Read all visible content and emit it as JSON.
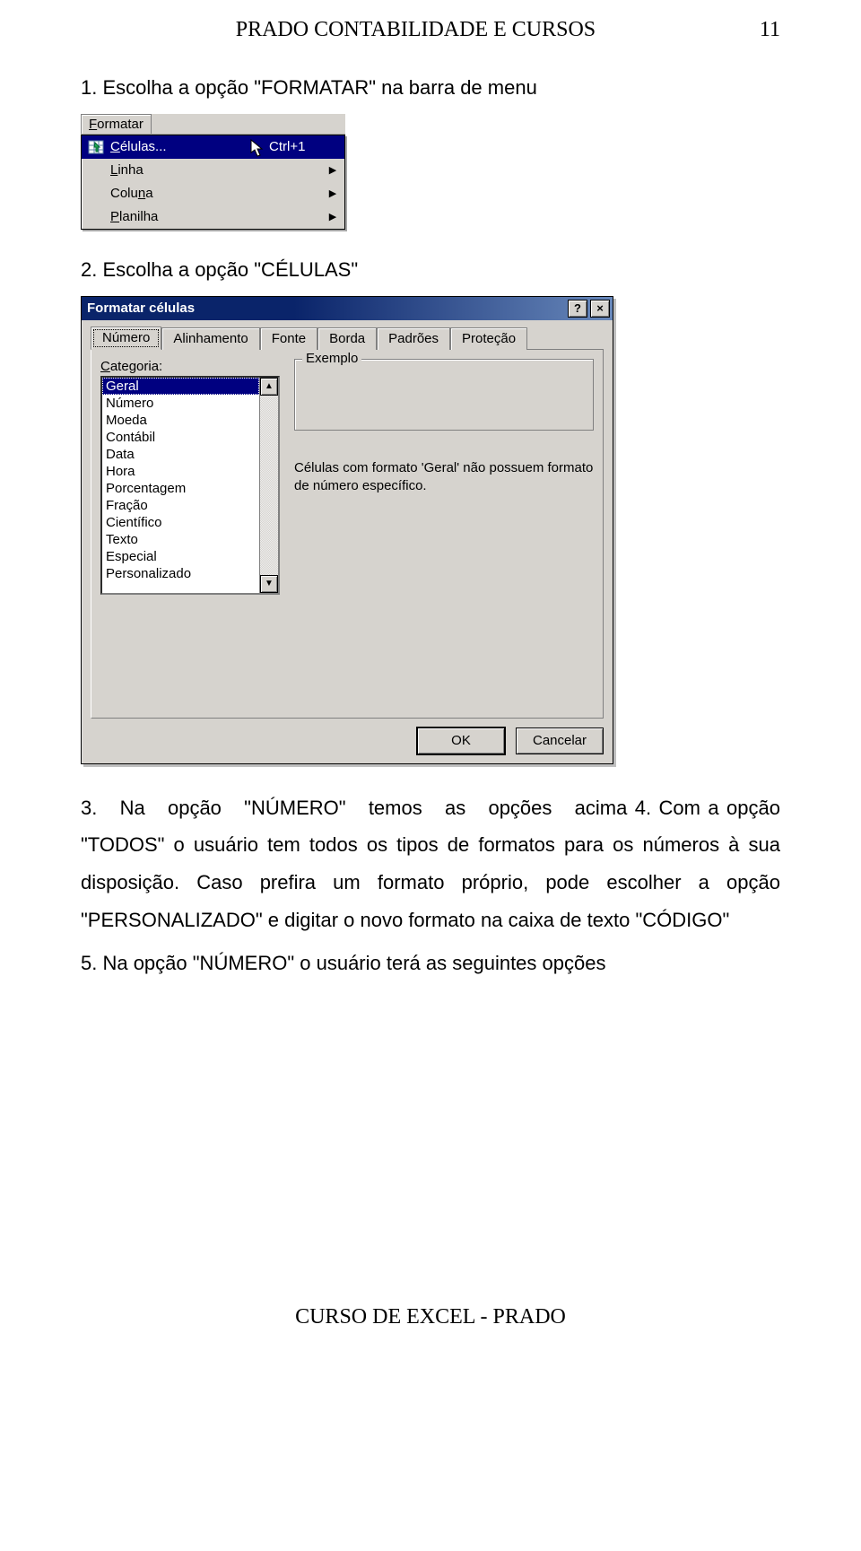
{
  "header": {
    "title": "PRADO CONTABILIDADE E CURSOS",
    "page_number": "11"
  },
  "step1": "1. Escolha a opção \"FORMATAR\" na barra de menu",
  "menu": {
    "bar_label": "Formatar",
    "items": [
      {
        "label": "Células...",
        "shortcut": "Ctrl+1",
        "selected": true,
        "leading_icon": "cells-icon",
        "submenu": false
      },
      {
        "label": "Linha",
        "shortcut": "",
        "selected": false,
        "leading_icon": "",
        "submenu": true
      },
      {
        "label": "Coluna",
        "shortcut": "",
        "selected": false,
        "leading_icon": "",
        "submenu": true
      },
      {
        "label": "Planilha",
        "shortcut": "",
        "selected": false,
        "leading_icon": "",
        "submenu": true
      }
    ]
  },
  "step2": "2. Escolha a opção \"CÉLULAS\"",
  "dialog": {
    "title": "Formatar células",
    "help_btn": "?",
    "close_btn": "×",
    "tabs": [
      "Número",
      "Alinhamento",
      "Fonte",
      "Borda",
      "Padrões",
      "Proteção"
    ],
    "active_tab": "Número",
    "category_label": "Categoria:",
    "categories": [
      "Geral",
      "Número",
      "Moeda",
      "Contábil",
      "Data",
      "Hora",
      "Porcentagem",
      "Fração",
      "Científico",
      "Texto",
      "Especial",
      "Personalizado"
    ],
    "selected_category": "Geral",
    "example_label": "Exemplo",
    "description": "Células com formato 'Geral' não possuem formato de número específico.",
    "ok_label": "OK",
    "cancel_label": "Cancelar"
  },
  "para3_prefix": "3.   Na   opção   \"NÚMERO\"   temos   as   opções   acima",
  "para4": "4. Com a opção \"TODOS\" o usuário tem todos os tipos de formatos para os números à sua disposição. Caso prefira um formato próprio, pode escolher a opção \"PERSONALIZADO\" e digitar o novo formato na caixa de texto \"CÓDIGO\"",
  "para5": "5. Na opção \"NÚMERO\" o usuário terá as seguintes opções",
  "footer": "CURSO DE EXCEL - PRADO"
}
